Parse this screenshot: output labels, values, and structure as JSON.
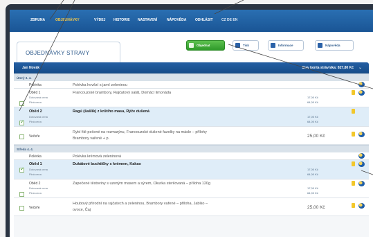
{
  "nav": {
    "items": [
      {
        "label": "ZBRUNA"
      },
      {
        "label": "OBJEDNÁVKY",
        "active": true
      },
      {
        "label": "VÝDEJ"
      },
      {
        "label": "HISTORIE"
      },
      {
        "label": "NASTAVENÍ"
      },
      {
        "label": "NÁPOVĚDA"
      },
      {
        "label": "ODHLÁSIT"
      }
    ],
    "lang": "CZ  DE  EN"
  },
  "page_title": "OBJEDNÁVKY STRAVY",
  "toolbar": {
    "order_label": "Objednat",
    "print_label": "Tisk",
    "info_label": "Informace",
    "help_label": "Nápověda"
  },
  "user": {
    "name": "Jan Novák",
    "credit": "Stav konta strávníka: 827,80 Kč"
  },
  "days": [
    {
      "label": "Úterý 3. 4.",
      "rows": [
        {
          "category": "Polévka",
          "food": "Polévka hovězí s jarní zeleninou",
          "checkbox": false
        },
        {
          "category": "Oběd 1",
          "sub1": "Dotovaná cena",
          "sub2": "Plná cena",
          "food": "Francouzské brambory, Rajčatový salát, Domácí limonáda",
          "price1": "17,00 Kč",
          "price2": "64,00 Kč",
          "checkbox": true,
          "checked": false
        },
        {
          "category": "Oběd 2",
          "sub1": "Dotovaná cena",
          "sub2": "Plná cena",
          "food": "Ragú (šašlik) z krůtího masa, Rýže dušená",
          "price1": "17,00 Kč",
          "price2": "64,00 Kč",
          "checkbox": true,
          "checked": true,
          "selected": true,
          "bold": true
        },
        {
          "category": "Večeře",
          "food": "Rybí filé pečené na rozmarýnu, Francouzské dušené fazolky na másle – přílohy",
          "food2": "Brambory vařené + p.",
          "bigprice": "25,00 Kč",
          "checkbox": true,
          "checked": false
        }
      ]
    },
    {
      "label": "Středa 4. 4.",
      "rows": [
        {
          "category": "Polévka",
          "food": "Polévka krémová zeleninová",
          "checkbox": false
        },
        {
          "category": "Oběd 1",
          "sub1": "Dotovaná cena",
          "sub2": "Plná cena",
          "food": "Dukátové buchtičky s krémem, Kakao",
          "price1": "17,00 Kč",
          "price2": "64,00 Kč",
          "checkbox": true,
          "checked": true,
          "selected": true,
          "bold": true
        },
        {
          "category": "Oběd 2",
          "sub1": "Dotovaná cena",
          "sub2": "Plná cena",
          "food": "Zapečené těstoviny s uzeným masem a sýrem, Okurka sterilovaná – příloha 120g",
          "price1": "17,00 Kč",
          "price2": "64,00 Kč",
          "checkbox": true,
          "checked": false
        },
        {
          "category": "Večeře",
          "food": "Houbový přírodní na rajčatech a zeleninou, Brambory vařené – příloha, Jablko –",
          "food2": "ovoce, Čaj",
          "bigprice": "25,00 Kč",
          "checkbox": true,
          "checked": false
        }
      ]
    }
  ],
  "colors": {
    "nav_bg": "#1a5595",
    "accent_green": "#2f9a2a",
    "selected_row": "#dfedf8",
    "header_row": "#d9e2ea"
  }
}
